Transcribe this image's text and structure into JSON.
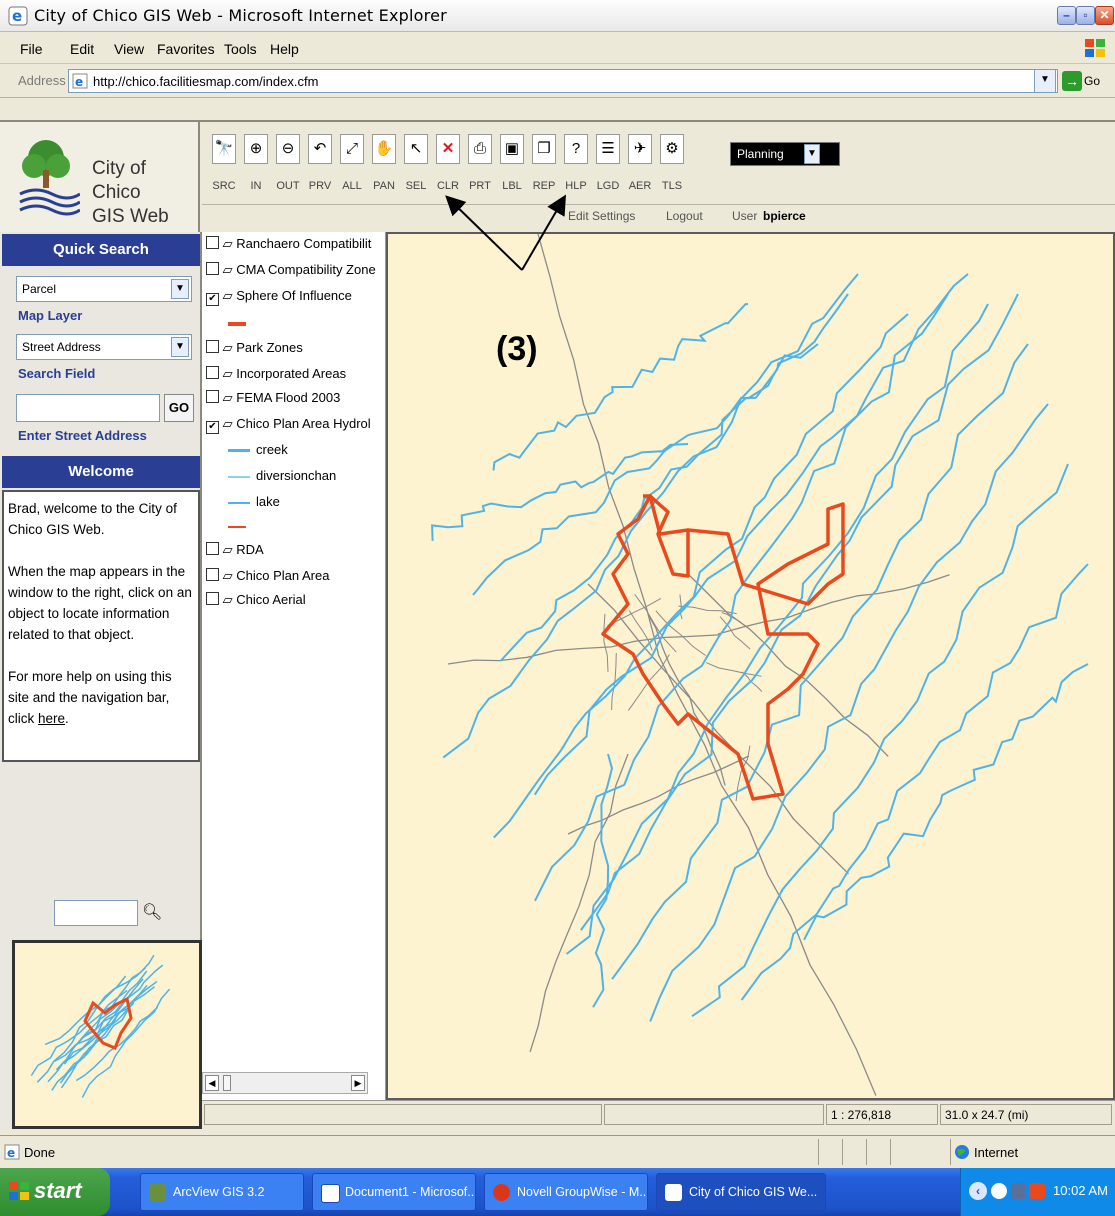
{
  "window": {
    "title": "City of Chico GIS Web - Microsoft Internet Explorer",
    "controls": [
      "minimize",
      "maximize",
      "close"
    ]
  },
  "menu": [
    "File",
    "Edit",
    "View",
    "Favorites",
    "Tools",
    "Help"
  ],
  "address": {
    "label": "Address",
    "url": "http://chico.facilitiesmap.com/index.cfm",
    "go_label": "Go"
  },
  "logo": {
    "line1": "City of Chico",
    "line2": "GIS Web"
  },
  "toolbar": {
    "tools": [
      {
        "label": "SRC",
        "icon": "binoculars-icon"
      },
      {
        "label": "IN",
        "icon": "zoom-in-icon"
      },
      {
        "label": "OUT",
        "icon": "zoom-out-icon"
      },
      {
        "label": "PRV",
        "icon": "zoom-previous-icon"
      },
      {
        "label": "ALL",
        "icon": "zoom-all-icon"
      },
      {
        "label": "PAN",
        "icon": "hand-icon"
      },
      {
        "label": "SEL",
        "icon": "arrow-pointer-icon"
      },
      {
        "label": "CLR",
        "icon": "red-x-icon"
      },
      {
        "label": "PRT",
        "icon": "printer-icon"
      },
      {
        "label": "LBL",
        "icon": "label-icon"
      },
      {
        "label": "REP",
        "icon": "report-icon"
      },
      {
        "label": "HLP",
        "icon": "help-icon"
      },
      {
        "label": "LGD",
        "icon": "legend-icon"
      },
      {
        "label": "AER",
        "icon": "airplane-icon"
      },
      {
        "label": "TLS",
        "icon": "tools-icon"
      }
    ],
    "planning_value": "Planning",
    "edit_settings": "Edit Settings",
    "logout": "Logout",
    "user_label": "User",
    "user_name": "bpierce"
  },
  "annotation_label": "(3)",
  "quick_search": {
    "title": "Quick Search",
    "map_layer_value": "Parcel",
    "map_layer_label": "Map Layer",
    "search_field_value": "Street Address",
    "search_field_label": "Search Field",
    "search_input_value": "",
    "go_label": "GO",
    "enter_label": "Enter Street Address"
  },
  "welcome": {
    "title": "Welcome",
    "p1": "Brad, welcome to the City of Chico GIS Web.",
    "p2": "When the map appears in the window to the right, click on an object to locate information related to that object.",
    "p3": "For more help on using this site and the navigation bar, click",
    "link": "here",
    "p3_end": "."
  },
  "layers": [
    {
      "name": "Ranchaero Compatibilit",
      "checked": false
    },
    {
      "name": "CMA Compatibility Zone",
      "checked": false
    },
    {
      "name": "Sphere Of Influence",
      "checked": true
    },
    {
      "name": "Park Zones",
      "checked": false
    },
    {
      "name": "Incorporated Areas",
      "checked": false
    },
    {
      "name": "FEMA Flood 2003",
      "checked": false
    },
    {
      "name": "Chico Plan Area Hydrol",
      "checked": true
    },
    {
      "name": "RDA",
      "checked": false
    },
    {
      "name": "Chico Plan Area",
      "checked": false
    },
    {
      "name": "Chico Aerial",
      "checked": false
    }
  ],
  "legend": {
    "creek": "creek",
    "diversionchan": "diversionchan",
    "lake": "lake"
  },
  "colors": {
    "boundary": "#e8491d",
    "water": "#4fb3e8",
    "roads": "#8a8a8a",
    "map_bg": "#fef3d0",
    "panel_blue": "#2a3f93"
  },
  "status": {
    "scale": "1 : 276,818",
    "extent": "31.0 x 24.7 (mi)",
    "ie_status": "Done",
    "zone": "Internet"
  },
  "taskbar": {
    "start": "start",
    "tasks": [
      "ArcView GIS 3.2",
      "Document1 - Microsof...",
      "Novell GroupWise - M...",
      "City of Chico GIS We..."
    ],
    "time": "10:02 AM"
  }
}
